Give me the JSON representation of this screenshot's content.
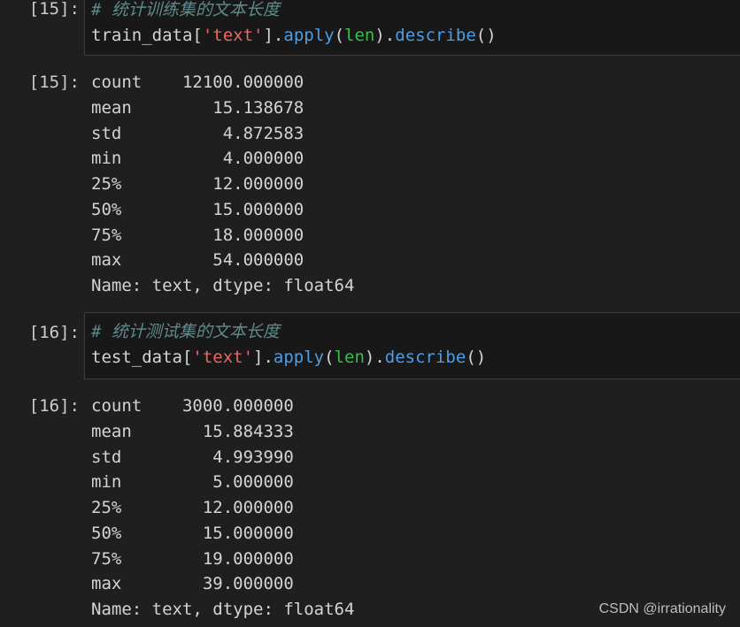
{
  "cells": [
    {
      "in_prompt": "[15]:",
      "comment": "# 统计训练集的文本长度",
      "code": {
        "var": "train_data[",
        "str": "'text'",
        "mid": "].",
        "m1": "apply",
        "p1": "(",
        "arg": "len",
        "p2": ").",
        "m2": "describe",
        "p3": "()"
      },
      "out_prompt": "[15]:",
      "output": [
        "count    12100.000000",
        "mean        15.138678",
        "std          4.872583",
        "min          4.000000",
        "25%         12.000000",
        "50%         15.000000",
        "75%         18.000000",
        "max         54.000000",
        "Name: text, dtype: float64"
      ]
    },
    {
      "in_prompt": "[16]:",
      "comment": "# 统计测试集的文本长度",
      "code": {
        "var": "test_data[",
        "str": "'text'",
        "mid": "].",
        "m1": "apply",
        "p1": "(",
        "arg": "len",
        "p2": ").",
        "m2": "describe",
        "p3": "()"
      },
      "out_prompt": "[16]:",
      "output": [
        "count    3000.000000",
        "mean       15.884333",
        "std         4.993990",
        "min         5.000000",
        "25%        12.000000",
        "50%        15.000000",
        "75%        19.000000",
        "max        39.000000",
        "Name: text, dtype: float64"
      ]
    }
  ],
  "watermark": "CSDN @irrationality"
}
